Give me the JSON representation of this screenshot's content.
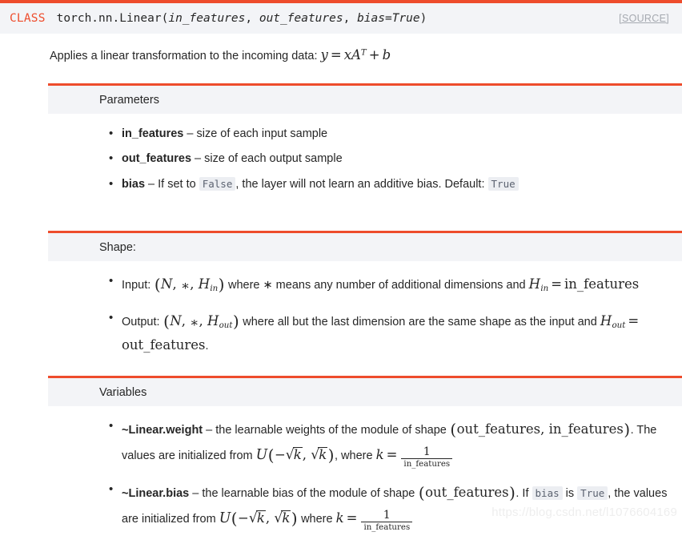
{
  "accent_color": "#ee4c2c",
  "header_bg": "#f3f4f7",
  "code_bg": "#eceef2",
  "signature": {
    "class_keyword": "CLASS",
    "module_path": "torch.nn.Linear(",
    "param1": "in_features",
    "sep1": ", ",
    "param2": "out_features",
    "sep2": ", ",
    "param3": "bias=True",
    "close": ")",
    "source_label": "[SOURCE]"
  },
  "intro": {
    "text": "Applies a linear transformation to the incoming data: ",
    "formula": "y = xA^T + b"
  },
  "sections": [
    {
      "id": "parameters",
      "title": "Parameters",
      "items": [
        {
          "name": "in_features",
          "desc": " – size of each input sample"
        },
        {
          "name": "out_features",
          "desc": " – size of each output sample"
        },
        {
          "name": "bias",
          "desc_before": " – If set to ",
          "code1": "False",
          "desc_mid": ", the layer will not learn an additive bias. Default: ",
          "code2": "True"
        }
      ]
    },
    {
      "id": "shape",
      "title": "Shape:",
      "items": [
        {
          "label": "Input: ",
          "tuple": "(N, *, H_in)",
          "mid": " where ∗ means any number of additional dimensions and ",
          "eq": "H_in = in_features"
        },
        {
          "label": "Output: ",
          "tuple": "(N, *, H_out)",
          "mid": " where all but the last dimension are the same shape as the input and ",
          "eq": "H_out = out_features",
          "period": "."
        }
      ]
    },
    {
      "id": "variables",
      "title": "Variables",
      "items": [
        {
          "name": "~Linear.weight",
          "desc_before": " – the learnable weights of the module of shape ",
          "shape": "(out_features, in_features)",
          "desc_mid": ". The values are initialized from ",
          "dist": "U(-√k, √k)",
          "desc_after": ", where ",
          "k_eq": "k = 1/in_features"
        },
        {
          "name": "~Linear.bias",
          "desc_before": " – the learnable bias of the module of shape ",
          "shape": "(out_features)",
          "desc_mid": ". If ",
          "code1": "bias",
          "desc_is": " is ",
          "code2": "True",
          "desc_after": ", the values are initialized from ",
          "dist": "U(-√k, √k)",
          "desc_where": " where ",
          "k_eq": "k = 1/in_features"
        }
      ]
    }
  ],
  "math_symbols": {
    "y": "y",
    "equals": "=",
    "x": "x",
    "A": "A",
    "T": "T",
    "plus": "+",
    "b": "b",
    "N": "N",
    "star": "∗",
    "H": "H",
    "in": "in",
    "out": "out",
    "in_features": "in_features",
    "out_features": "out_features",
    "cal_U": "U",
    "minus": "−",
    "k": "k",
    "comma": ",",
    "one": "1"
  },
  "watermark": "https://blog.csdn.net/l1076604169"
}
